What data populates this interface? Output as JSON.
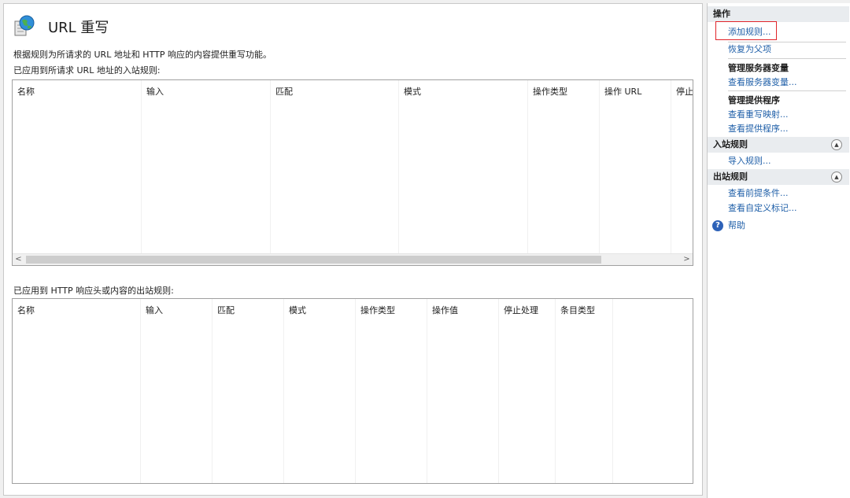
{
  "header": {
    "title": "URL 重写",
    "description": "根据规则为所请求的 URL 地址和 HTTP 响应的内容提供重写功能。"
  },
  "inbound": {
    "label": "已应用到所请求 URL 地址的入站规则:",
    "columns": [
      "名称",
      "输入",
      "匹配",
      "模式",
      "操作类型",
      "操作 URL",
      "停止"
    ]
  },
  "outbound": {
    "label": "已应用到 HTTP 响应头或内容的出站规则:",
    "columns": [
      "名称",
      "输入",
      "匹配",
      "模式",
      "操作类型",
      "操作值",
      "停止处理",
      "条目类型"
    ]
  },
  "scrollbar": {
    "left_arrow": "<",
    "right_arrow": ">"
  },
  "actions": {
    "title": "操作",
    "add_rule": "添加规则...",
    "revert_parent": "恢复为父项",
    "manage_server_vars": "管理服务器变量",
    "view_server_vars": "查看服务器变量...",
    "manage_providers": "管理提供程序",
    "view_rewrite_maps": "查看重写映射...",
    "view_providers": "查看提供程序...",
    "inbound_title": "入站规则",
    "import_rules": "导入规则...",
    "outbound_title": "出站规则",
    "view_preconditions": "查看前提条件...",
    "view_custom_tags": "查看自定义标记...",
    "help": "帮助",
    "help_icon_glyph": "?",
    "collapse_glyph": "▲"
  },
  "colors": {
    "link": "#1f5fa8",
    "highlight_box": "#e0242a",
    "section_header_bg": "#e9ecef"
  }
}
